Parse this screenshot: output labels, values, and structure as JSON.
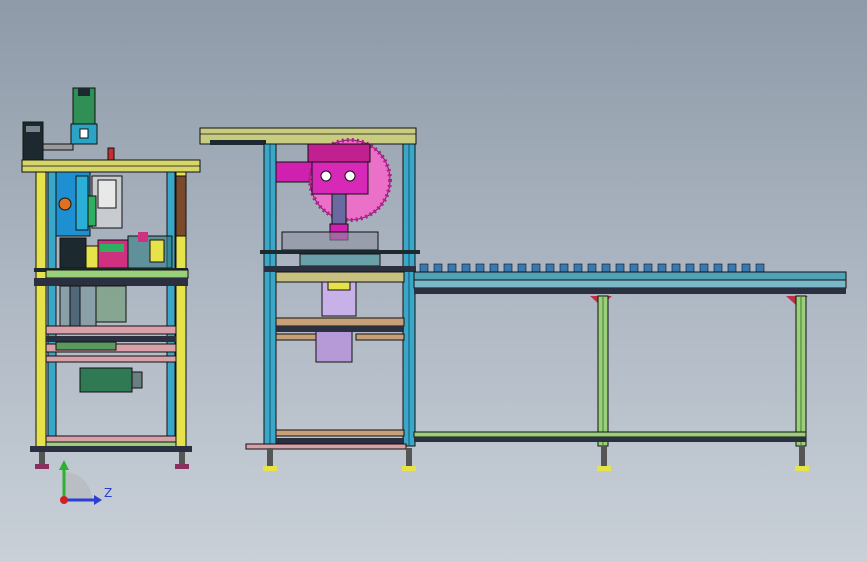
{
  "app": {
    "view": "cad-3d-viewport"
  },
  "triad": {
    "z_label": "Z",
    "icon": "axis-triad-icon"
  },
  "colors": {
    "background_top": "#8e9aa8",
    "background_bottom": "#c9d0d8",
    "frame_yellow": "#e6e24a",
    "frame_blue": "#3aa6c8",
    "frame_green": "#9bd07a",
    "frame_pink": "#d8a0a8",
    "magenta": "#d020b0",
    "purple": "#b69ad8",
    "conveyor": "#4fa3b8",
    "dark": "#1c2a30"
  },
  "objects": [
    "left-machine-station",
    "center-press-station",
    "roller-conveyor",
    "leveling-feet"
  ]
}
